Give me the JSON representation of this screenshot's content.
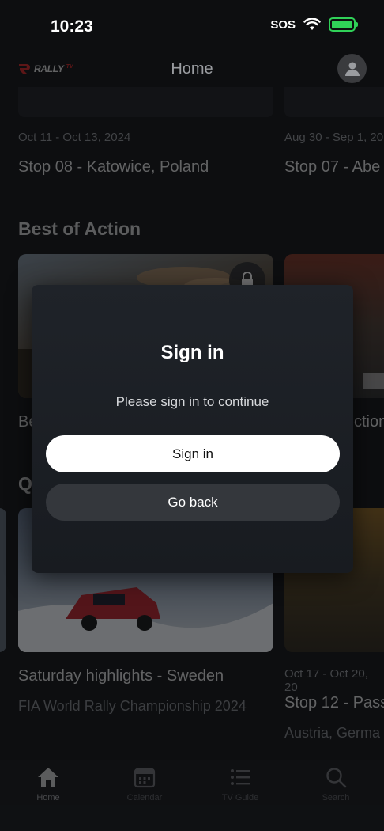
{
  "status_bar": {
    "time": "10:23",
    "sos": "SOS"
  },
  "header": {
    "logo_text": "RALLY",
    "logo_tv": "TV",
    "title": "Home"
  },
  "rows": {
    "previous": [
      {
        "date": "Oct 11 - Oct 13, 2024",
        "title": "Stop 08 - Katowice, Poland"
      },
      {
        "date": "Aug 30 - Sep 1, 20",
        "title": "Stop 07 - Abe"
      }
    ],
    "best_of_action": {
      "heading": "Best of Action",
      "cards": [
        {
          "title_fragment": "Be"
        },
        {
          "title_fragment": "ction"
        }
      ]
    },
    "next_heading_fragment": "Q",
    "bottom": [
      {
        "title": "Saturday highlights - Sweden",
        "subtitle": "FIA World Rally Championship 2024"
      },
      {
        "date": "Oct 17 - Oct 20, 20",
        "title": "Stop 12 - Pass",
        "subtitle": "Austria, Germa"
      }
    ]
  },
  "modal": {
    "title": "Sign in",
    "message": "Please sign in to continue",
    "primary_label": "Sign in",
    "secondary_label": "Go back"
  },
  "tabs": [
    {
      "label": "Home",
      "icon": "home-icon",
      "active": true
    },
    {
      "label": "Calendar",
      "icon": "calendar-icon"
    },
    {
      "label": "TV Guide",
      "icon": "list-icon"
    },
    {
      "label": "Search",
      "icon": "search-icon"
    }
  ],
  "colors": {
    "background": "#0d0e10",
    "modal": "#1f2329",
    "primary_button": "#ffffff",
    "secondary_button": "#34373c",
    "battery": "#30d158",
    "brand_red": "#cc2222"
  }
}
